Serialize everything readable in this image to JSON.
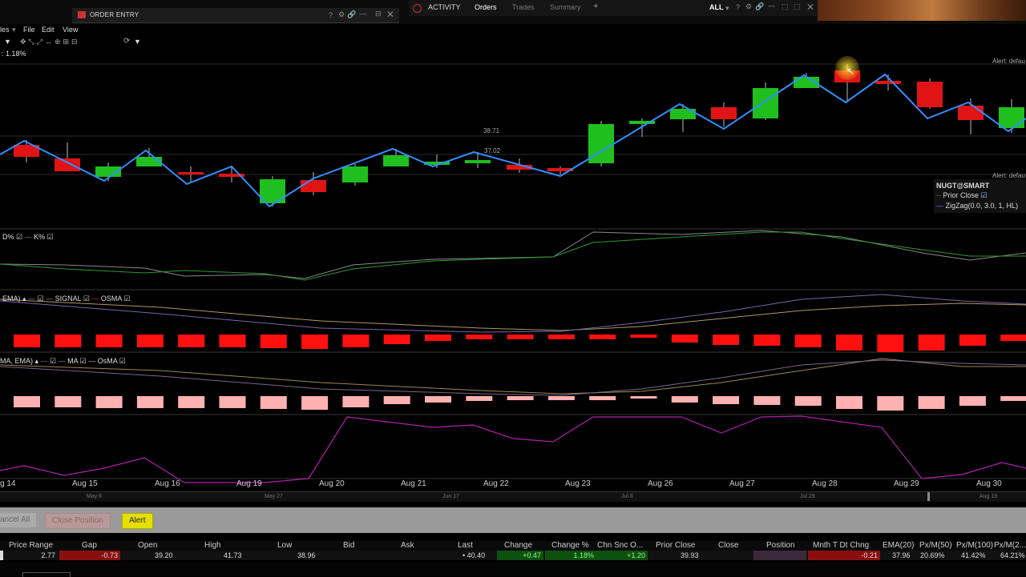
{
  "order_entry": {
    "title": "ORDER ENTRY",
    "help": "?"
  },
  "activity": {
    "title": "ACTIVITY",
    "tabs": [
      "Orders",
      "Trades",
      "Summary"
    ],
    "add": "+",
    "filter": "ALL"
  },
  "menu": {
    "partial": "les",
    "file": "File",
    "edit": "Edit",
    "view": "View"
  },
  "chart": {
    "change_label": ": 1.18%",
    "price_labels": {
      "p1": "38.71",
      "p2": "37.02"
    },
    "alert_label": "Alert: defau",
    "legend": {
      "symbol": "NUGT@SMART",
      "prior_close": "Prior Close",
      "zigzag": "ZigZag(0.0, 3.0, 1, HL)"
    },
    "stoch_legend": {
      "d": "D%",
      "k": "K%"
    },
    "macd_legend": {
      "ema": "EMA)",
      "signal": "SIGNAL",
      "osma": "OSMA"
    },
    "osma2_legend": {
      "ema": "MA, EMA)",
      "ma": "MA",
      "osma": "OsMA"
    },
    "dates": [
      "g 14",
      "Aug 15",
      "Aug 16",
      "Aug 19",
      "Aug 20",
      "Aug 21",
      "Aug 22",
      "Aug 23",
      "Aug 26",
      "Aug 27",
      "Aug 28",
      "Aug 29",
      "Aug 30"
    ],
    "nav_dates": [
      "May 6",
      "May 27",
      "Jun 17",
      "Jul 8",
      "Jul 29",
      "Aug 19"
    ],
    "colors": {
      "up": "#1fbf1f",
      "down": "#e01414",
      "zigzag": "#2f8fff",
      "osma": "#ff1010",
      "osma2": "#ffb0b0",
      "rsi": "#b020b0"
    }
  },
  "buttons": {
    "cancel_all": "ancel All",
    "close_position": "Close Position",
    "alert": "Alert"
  },
  "table": {
    "headers": [
      "Price Range",
      "Gap",
      "Open",
      "High",
      "Low",
      "Bid",
      "Ask",
      "Last",
      "Change",
      "Change %",
      "Chn Snc O...",
      "Prior Close",
      "Close",
      "Position",
      "Mnth T Dt Chng",
      "EMA(20)",
      "Px/M(50)",
      "Px/M(100)",
      "Px/M(2..."
    ],
    "values": {
      "price_range": "2.77",
      "gap": "-0.73",
      "open": "39.20",
      "high": "41.73",
      "low": "38.96",
      "bid": "",
      "ask": "",
      "last": "• 40.40",
      "change": "+0.47",
      "change_pct": "1.18%",
      "chn_snc": "+1.20",
      "prior_close": "39.93",
      "close": "",
      "position": "",
      "mtd": "-0.21",
      "ema20": "37.96",
      "pxm50": "20.69%",
      "pxm100": "41.42%",
      "pxm200": "64.21%"
    }
  }
}
